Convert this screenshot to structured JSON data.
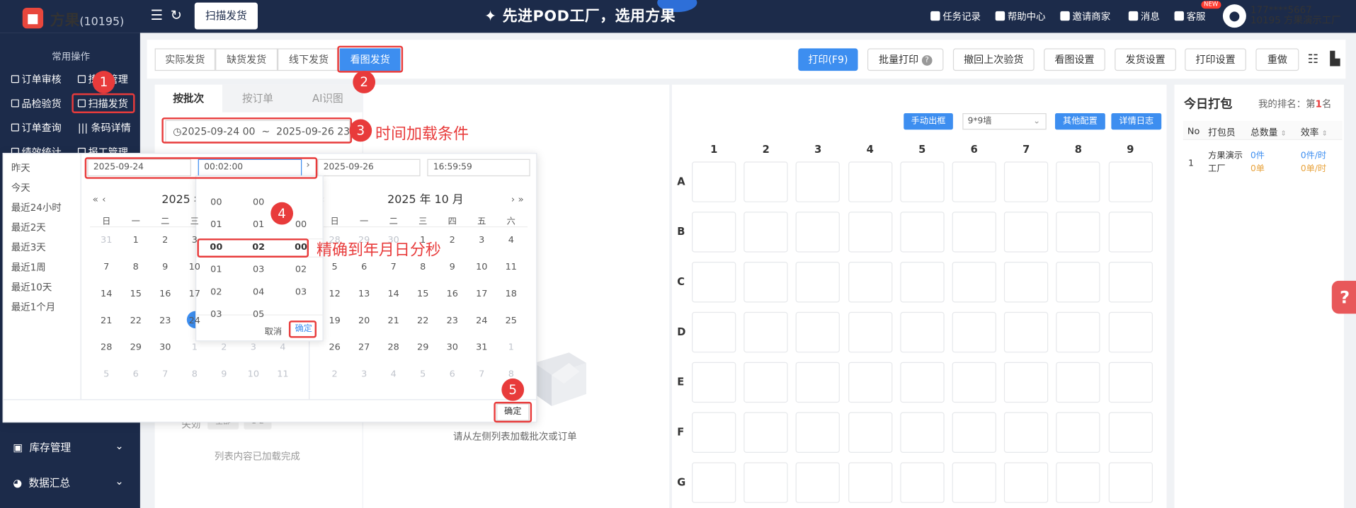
{
  "topbar": {
    "brand": "方果",
    "brand_num": "(10195)",
    "active_tab": "扫描发货",
    "banner": "✦ 先进POD工厂，选用方果",
    "menu": [
      "任务记录",
      "帮助中心",
      "邀请商家",
      "消息",
      "客服"
    ],
    "new_badge": "NEW",
    "user_phone": "177****5667",
    "user_name": "10195  方果演示工厂"
  },
  "sidebar": {
    "section_title": "常用操作",
    "items": [
      "订单审核",
      "拣货管理",
      "品检验货",
      "扫描发货",
      "订单查询",
      "条码详情",
      "绩效统计",
      "报工管理"
    ],
    "groups": [
      "库存管理",
      "数据汇总"
    ]
  },
  "shipping_tabs": [
    "实际发货",
    "缺货发货",
    "线下发货",
    "看图发货"
  ],
  "toolbar": {
    "print": "打印(F9)",
    "batch_print": "批量打印",
    "undo_check": "撤回上次验货",
    "view_settings": "看图设置",
    "ship_settings": "发货设置",
    "print_settings": "打印设置",
    "redo": "重做"
  },
  "left_panel": {
    "tabs": [
      "按批次",
      "按订单",
      "AI识图"
    ],
    "range_start": "2025-09-24 00",
    "range_sep": "~",
    "range_end": "2025-09-26 23",
    "footer_text": "列表内容已加载完成",
    "partial_label": "失効",
    "partial_chip1": "全部",
    "partial_chip2": "1-2"
  },
  "center_panel": {
    "empty_text": "请从左侧列表加载批次或订单"
  },
  "grid_panel": {
    "manual_out": "手动出框",
    "wall_select": "9*9墙",
    "other_config": "其他配置",
    "detail_log": "详情日志",
    "columns": [
      "1",
      "2",
      "3",
      "4",
      "5",
      "6",
      "7",
      "8",
      "9"
    ],
    "rows": [
      "A",
      "B",
      "C",
      "D",
      "E",
      "F",
      "G"
    ]
  },
  "right_panel": {
    "title": "今日打包",
    "rank_label": "我的排名：第",
    "rank_value": "1",
    "rank_suffix": "名",
    "headers": [
      "No",
      "打包员",
      "总数量",
      "效率"
    ],
    "row": {
      "no": "1",
      "packer_line1": "方果演示",
      "packer_line2": "工厂",
      "qty1": "0件",
      "qty2": "0单",
      "eff1": "0件/时",
      "eff2": "0单/时"
    }
  },
  "date_popup": {
    "shortcuts": [
      "昨天",
      "今天",
      "最近24小时",
      "最近2天",
      "最近3天",
      "最近1周",
      "最近10天",
      "最近1个月"
    ],
    "start_date": "2025-09-24",
    "start_time": "00:02:00",
    "end_date": "2025-09-26",
    "end_time": "16:59:59",
    "left_cal_header": "2025 年",
    "right_cal_header": "2025 年 10 月",
    "weekdays": [
      "日",
      "一",
      "二",
      "三",
      "四",
      "五",
      "六"
    ],
    "left_grid": [
      [
        "31",
        "1",
        "2",
        "3"
      ],
      [
        "7",
        "8",
        "9",
        "10"
      ],
      [
        "14",
        "15",
        "16",
        "17"
      ],
      [
        "21",
        "22",
        "23",
        "24"
      ],
      [
        "28",
        "29",
        "30",
        "1",
        "2",
        "3",
        "4"
      ],
      [
        "5",
        "6",
        "7",
        "8",
        "9",
        "10",
        "11"
      ]
    ],
    "right_grid": [
      [
        "28",
        "29",
        "30",
        "1",
        "2",
        "3",
        "4"
      ],
      [
        "5",
        "6",
        "7",
        "8",
        "9",
        "10",
        "11"
      ],
      [
        "12",
        "13",
        "14",
        "15",
        "16",
        "17",
        "18"
      ],
      [
        "19",
        "20",
        "21",
        "22",
        "23",
        "24",
        "25"
      ],
      [
        "26",
        "27",
        "28",
        "29",
        "30",
        "31",
        "1"
      ],
      [
        "2",
        "3",
        "4",
        "5",
        "6",
        "7",
        "8"
      ]
    ],
    "time_columns": {
      "hours": [
        "00",
        "01",
        "00",
        "01",
        "02",
        "03"
      ],
      "minutes": [
        "00",
        "01",
        "02",
        "03",
        "04",
        "05"
      ],
      "seconds": [
        "00",
        "01",
        "02",
        "03"
      ]
    },
    "time_selected": [
      "00",
      "02",
      "00"
    ],
    "cancel": "取消",
    "confirm": "确定",
    "main_confirm": "确定"
  },
  "annotations": {
    "badges": [
      "1",
      "2",
      "3",
      "4",
      "5"
    ],
    "note_time": "时间加载条件",
    "note_precision": "精确到年月日分秒"
  }
}
